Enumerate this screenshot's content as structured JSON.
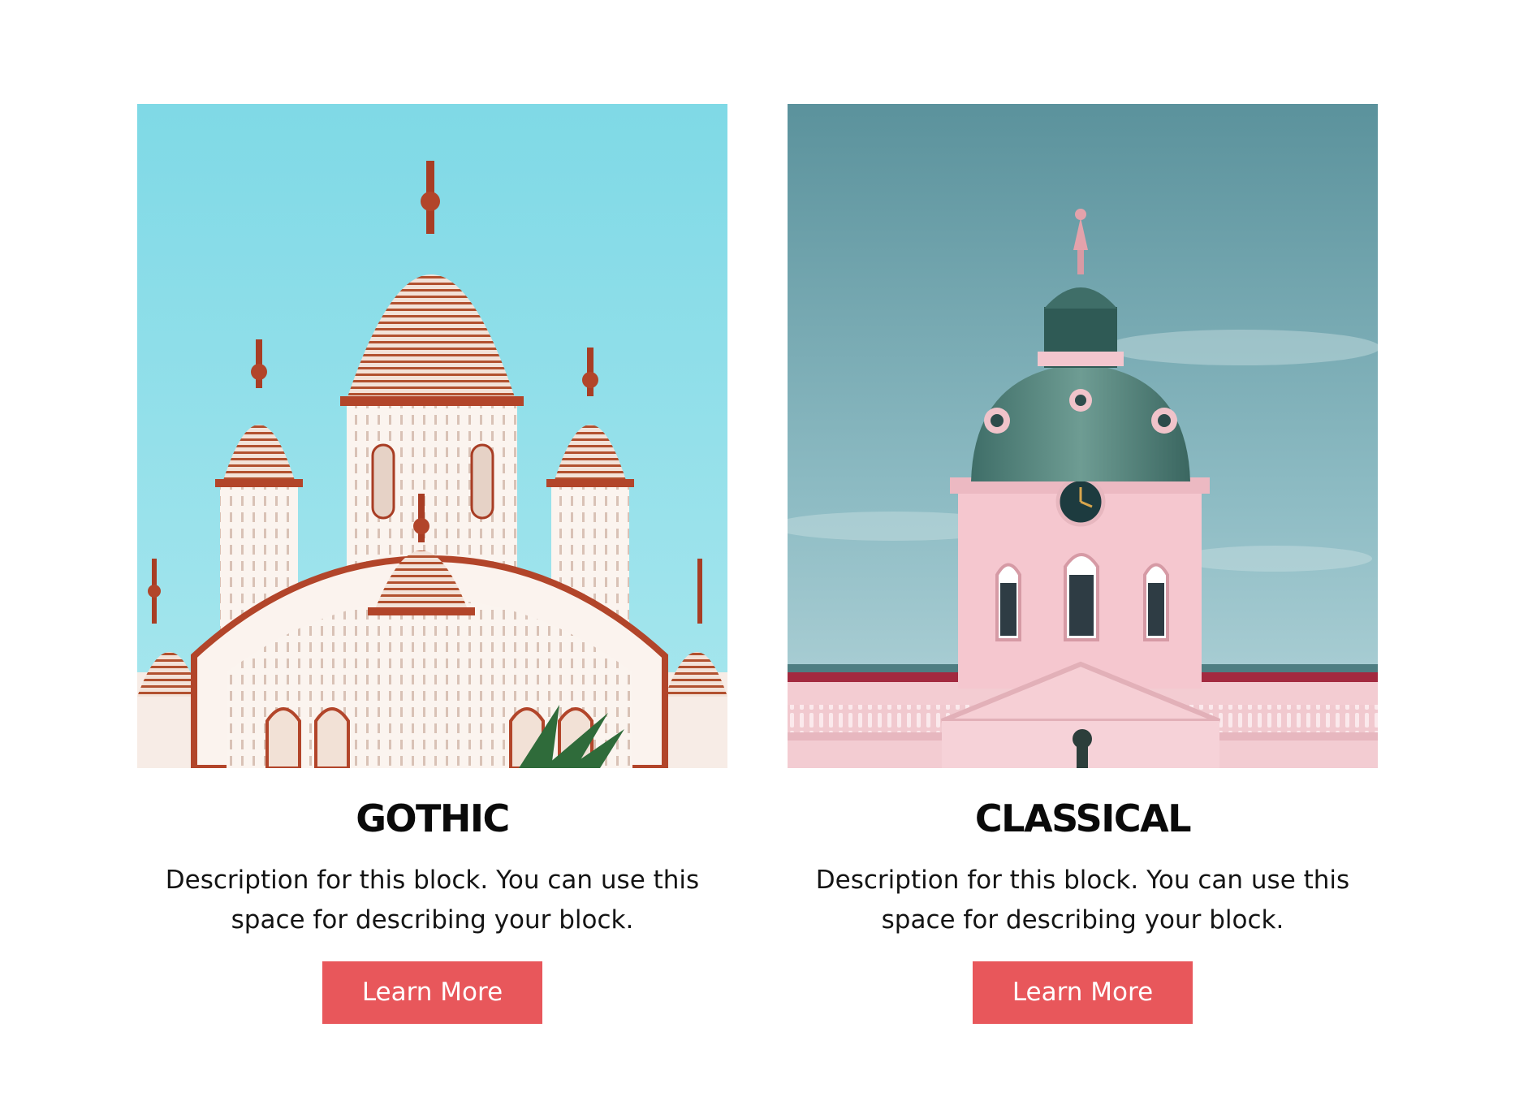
{
  "cards": [
    {
      "title": "GOTHIC",
      "description": "Description for this block. You can use this space for describing your block.",
      "button_label": "Learn More",
      "image": "temple-domes-photo"
    },
    {
      "title": "CLASSICAL",
      "description": "Description for this block. You can use this space for describing your block.",
      "button_label": "Learn More",
      "image": "palace-dome-photo"
    }
  ],
  "colors": {
    "button": "#e8575b",
    "button_text": "#ffffff",
    "background": "#ffffff",
    "title": "#0a0a0a"
  }
}
